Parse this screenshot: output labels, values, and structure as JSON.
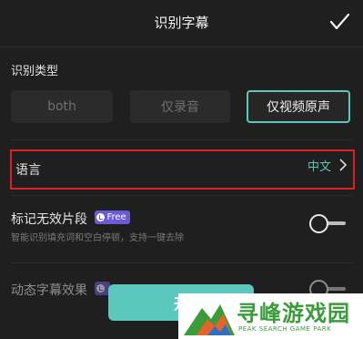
{
  "header": {
    "title": "识别字幕",
    "confirm_icon": "checkmark-icon"
  },
  "recognition_type": {
    "label": "识别类型",
    "options": [
      "both",
      "仅录音",
      "仅视频原声"
    ],
    "selected": "仅视频原声"
  },
  "language": {
    "label": "语言",
    "value": "中文"
  },
  "mark_invalid": {
    "title": "标记无效片段",
    "badge": "Free",
    "description": "智能识别填充词和空白停顿，支持一键去除",
    "enabled": false
  },
  "dynamic_subtitle": {
    "title": "动态字幕效果",
    "enabled": false
  },
  "start_button": {
    "label": "开"
  },
  "watermark": {
    "name": "寻峰游戏园",
    "sub": "PEAK SEARCH GAME PARK"
  },
  "colors": {
    "accent": "#5cc7bc",
    "highlight_border": "#e02020",
    "badge": "#6b5bd6",
    "background": "#1f1f1f"
  }
}
